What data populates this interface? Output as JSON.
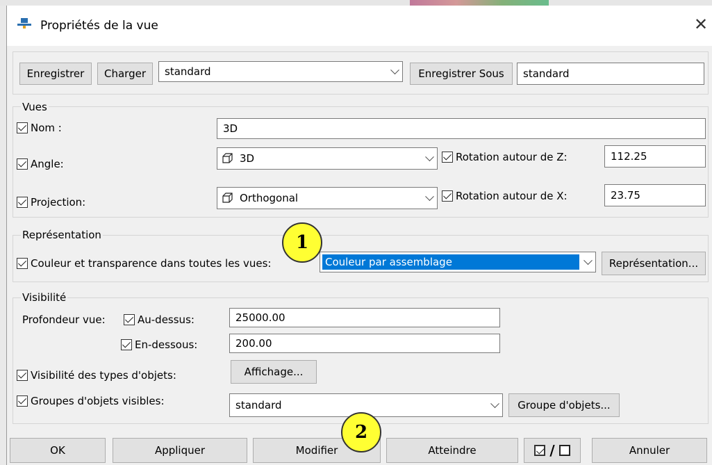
{
  "window": {
    "title": "Propriétés de la vue",
    "close_icon": "close-icon"
  },
  "toolbar": {
    "save_label": "Enregistrer",
    "load_label": "Charger",
    "preset_value": "standard",
    "save_as_label": "Enregistrer Sous",
    "save_as_value": "standard"
  },
  "views": {
    "group_title": "Vues",
    "name_label": "Nom :",
    "name_value": "3D",
    "angle_label": "Angle:",
    "angle_value": "3D",
    "rotz_label": "Rotation autour de Z:",
    "rotz_value": "112.25",
    "projection_label": "Projection:",
    "projection_value": "Orthogonal",
    "rotx_label": "Rotation autour de X:",
    "rotx_value": "23.75"
  },
  "representation": {
    "group_title": "Représentation",
    "color_label": "Couleur et transparence dans toutes les vues:",
    "color_value": "Couleur par assemblage",
    "button_label": "Représentation..."
  },
  "visibility": {
    "group_title": "Visibilité",
    "depth_label": "Profondeur vue:",
    "above_label": "Au-dessus:",
    "above_value": "25000.00",
    "below_label": "En-dessous:",
    "below_value": "200.00",
    "types_label": "Visibilité des types d'objets:",
    "display_button": "Affichage...",
    "groups_label": "Groupes d'objets visibles:",
    "groups_value": "standard",
    "groups_button": "Groupe d'objets..."
  },
  "buttons": {
    "ok": "OK",
    "apply": "Appliquer",
    "modify": "Modifier",
    "reach": "Atteindre",
    "toggle": "/",
    "cancel": "Annuler"
  },
  "markers": {
    "one": "1",
    "two": "2"
  }
}
